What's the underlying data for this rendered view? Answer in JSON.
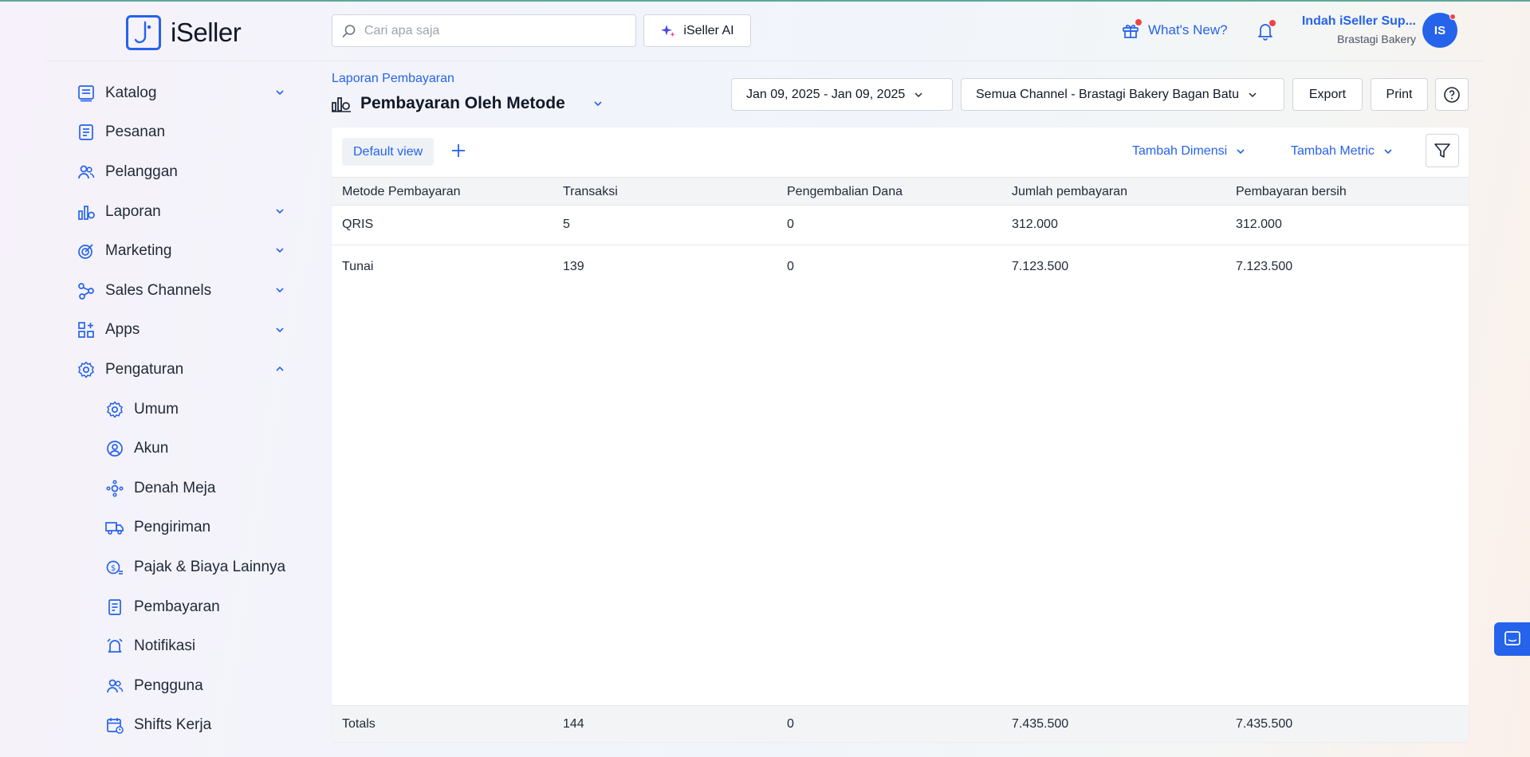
{
  "app": {
    "logo_text": "iSeller"
  },
  "header": {
    "search_placeholder": "Cari apa saja",
    "ai_button": "iSeller AI",
    "whats_new": "What's New?",
    "user_name": "Indah iSeller Sup...",
    "user_store": "Brastagi Bakery",
    "avatar_initials": "IS"
  },
  "sidebar": {
    "items": [
      {
        "label": "Katalog",
        "icon": "catalog-icon",
        "expandable": true,
        "expanded": false
      },
      {
        "label": "Pesanan",
        "icon": "orders-icon",
        "expandable": false
      },
      {
        "label": "Pelanggan",
        "icon": "customers-icon",
        "expandable": false
      },
      {
        "label": "Laporan",
        "icon": "reports-icon",
        "expandable": true,
        "expanded": false
      },
      {
        "label": "Marketing",
        "icon": "marketing-icon",
        "expandable": true,
        "expanded": false
      },
      {
        "label": "Sales Channels",
        "icon": "sales-channels-icon",
        "expandable": true,
        "expanded": false
      },
      {
        "label": "Apps",
        "icon": "apps-icon",
        "expandable": true,
        "expanded": false
      },
      {
        "label": "Pengaturan",
        "icon": "settings-icon",
        "expandable": true,
        "expanded": true
      }
    ],
    "sub_items": [
      {
        "label": "Umum",
        "icon": "gear-icon"
      },
      {
        "label": "Akun",
        "icon": "user-circle-icon"
      },
      {
        "label": "Denah Meja",
        "icon": "table-layout-icon"
      },
      {
        "label": "Pengiriman",
        "icon": "truck-icon"
      },
      {
        "label": "Pajak & Biaya Lainnya",
        "icon": "tax-icon"
      },
      {
        "label": "Pembayaran",
        "icon": "payment-icon"
      },
      {
        "label": "Notifikasi",
        "icon": "alarm-icon"
      },
      {
        "label": "Pengguna",
        "icon": "users-icon"
      },
      {
        "label": "Shifts Kerja",
        "icon": "calendar-icon"
      }
    ]
  },
  "page": {
    "breadcrumb": "Laporan Pembayaran",
    "title": "Pembayaran Oleh Metode",
    "date_range": "Jan 09, 2025 - Jan 09, 2025",
    "channel": "Semua Channel - Brastagi Bakery Bagan Batu",
    "export_label": "Export",
    "print_label": "Print"
  },
  "report": {
    "view_tab": "Default view",
    "add_dimension": "Tambah Dimensi",
    "add_metric": "Tambah Metric",
    "columns": [
      "Metode Pembayaran",
      "Transaksi",
      "Pengembalian Dana",
      "Jumlah pembayaran",
      "Pembayaran bersih"
    ],
    "rows": [
      [
        "QRIS",
        "5",
        "0",
        "312.000",
        "312.000"
      ],
      [
        "Tunai",
        "139",
        "0",
        "7.123.500",
        "7.123.500"
      ]
    ],
    "totals": [
      "Totals",
      "144",
      "0",
      "7.435.500",
      "7.435.500"
    ]
  },
  "colors": {
    "accent": "#2563eb",
    "notification_dot": "#ef4444"
  }
}
